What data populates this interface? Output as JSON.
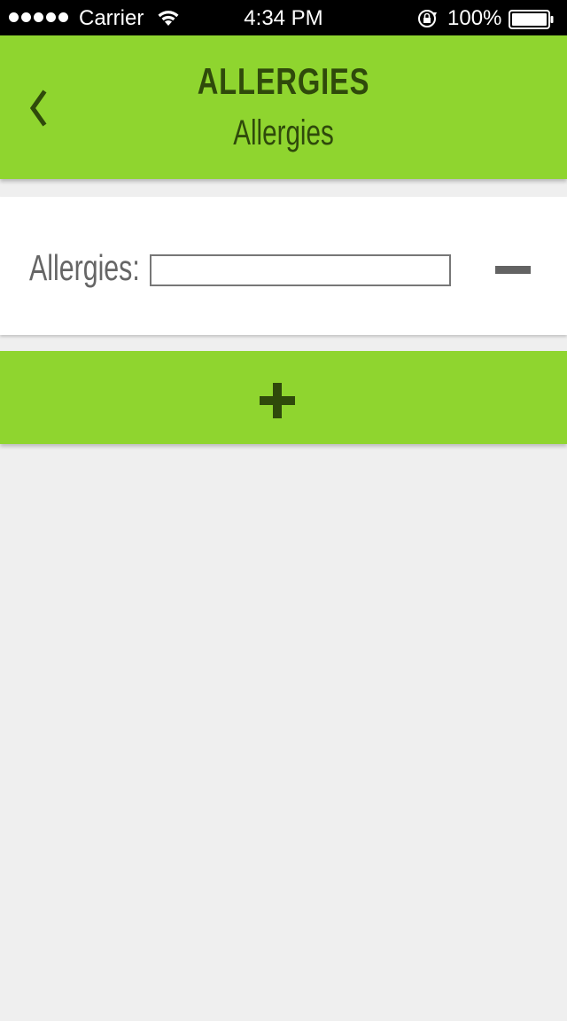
{
  "status_bar": {
    "carrier": "Carrier",
    "time": "4:34 PM",
    "battery": "100%"
  },
  "header": {
    "title": "ALLERGIES",
    "subtitle": "Allergies"
  },
  "form": {
    "fields": [
      {
        "label": "Allergies:",
        "value": ""
      }
    ]
  },
  "icons": {
    "back": "chevron-left-icon",
    "remove": "minus-icon",
    "add": "plus-icon"
  },
  "colors": {
    "accent": "#8fd52f",
    "accent_dark": "#2f4a0b",
    "background": "#efefef",
    "label": "#666666"
  }
}
